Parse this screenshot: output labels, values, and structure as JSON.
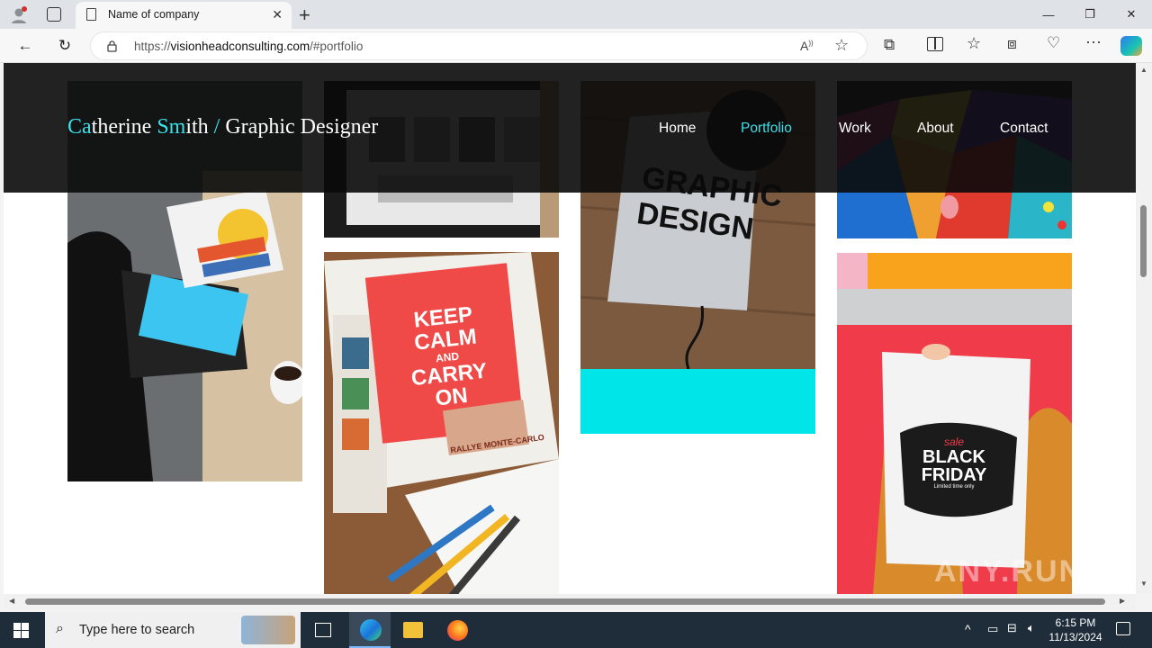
{
  "browser": {
    "tab_title": "Name of company",
    "url_prefix": "https://",
    "url_domain": "visionheadconsulting.com",
    "url_suffix": "/#portfolio"
  },
  "site": {
    "brand": {
      "a1": "Ca",
      "t1": "therine ",
      "a2": "Sm",
      "t2": "ith ",
      "a3": "/",
      "t3": " Graphic Designer"
    },
    "menu": [
      "Home",
      "Portfolio",
      "Work",
      "About",
      "Contact"
    ],
    "active_menu": "Portfolio",
    "accent_color": "#3de0e8"
  },
  "portfolio": {
    "keep_calm": [
      "KEEP",
      "CALM",
      "AND",
      "CARRY",
      "ON"
    ],
    "book": [
      "GRAPHIC",
      "DESIGN"
    ],
    "black_friday": {
      "sale": "sale",
      "line1": "BLACK",
      "line2": "FRIDAY",
      "line3": "Limited time only"
    },
    "monte_carlo": "RALLYE MONTE-CARLO"
  },
  "watermark": "ANY.RUN",
  "taskbar": {
    "search_placeholder": "Type here to search",
    "time": "6:15 PM",
    "date": "11/13/2024"
  }
}
